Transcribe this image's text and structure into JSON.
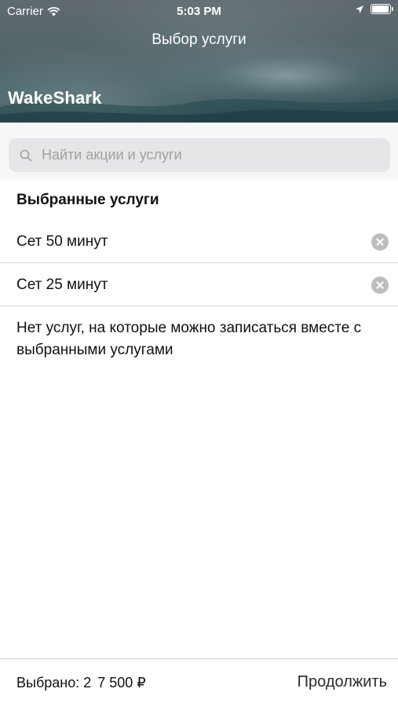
{
  "status_bar": {
    "carrier": "Carrier",
    "time": "5:03 PM"
  },
  "header": {
    "title": "Выбор услуги",
    "brand": "WakeShark"
  },
  "search": {
    "placeholder": "Найти акции и услуги",
    "value": ""
  },
  "selected_section": {
    "title": "Выбранные услуги",
    "items": [
      {
        "label": "Сет 50 минут"
      },
      {
        "label": "Сет 25 минут"
      }
    ],
    "empty_note": "Нет услуг, на которые можно записаться вместе с выбранными услугами"
  },
  "footer": {
    "selected_label": "Выбрано: 2",
    "total": "7 500 ₽",
    "continue_label": "Продолжить"
  },
  "colors": {
    "search_bg": "#e6e6e8",
    "remove_icon_bg": "#bdbdbf",
    "divider": "#d5d5d8"
  }
}
